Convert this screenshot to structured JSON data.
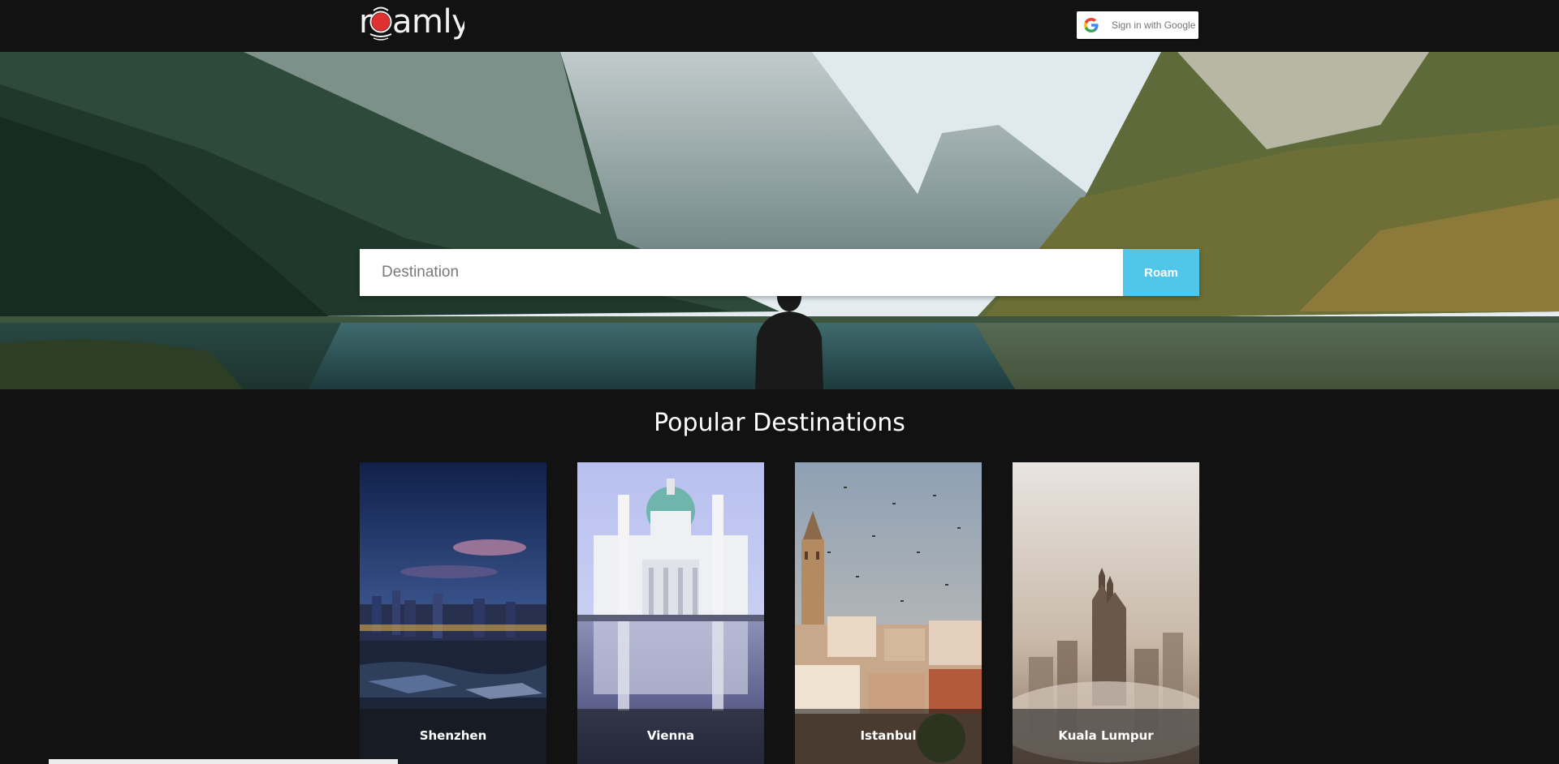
{
  "header": {
    "logo_text": "roamly",
    "sign_in_label": "Sign in with Google"
  },
  "search": {
    "placeholder": "Destination",
    "value": "",
    "button_label": "Roam"
  },
  "popular": {
    "title": "Popular Destinations",
    "destinations": [
      {
        "name": "Shenzhen"
      },
      {
        "name": "Vienna"
      },
      {
        "name": "Istanbul"
      },
      {
        "name": "Kuala Lumpur"
      }
    ]
  },
  "colors": {
    "background": "#121212",
    "accent": "#4fc6ea",
    "logo_dot": "#e0302f"
  }
}
